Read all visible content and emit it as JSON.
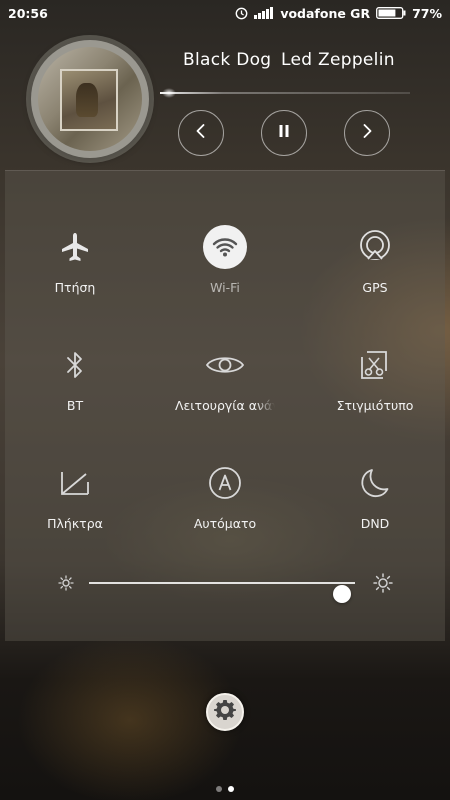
{
  "status_bar": {
    "time": "20:56",
    "carrier": "vodafone GR",
    "battery_percent": "77%",
    "battery_level": 0.77,
    "icons": [
      "alarm-icon",
      "signal-icon",
      "battery-icon"
    ]
  },
  "player": {
    "title": "Black Dog",
    "artist": "Led Zeppelin",
    "controls": [
      "previous-icon",
      "pause-icon",
      "next-icon"
    ]
  },
  "quick_settings": {
    "tiles": [
      {
        "label": "Πτήση",
        "icon": "airplane-icon",
        "active": false
      },
      {
        "label": "Wi-Fi",
        "icon": "wifi-icon",
        "active": true
      },
      {
        "label": "GPS",
        "icon": "gps-icon",
        "active": false
      },
      {
        "label": "BT",
        "icon": "bluetooth-icon",
        "active": false
      },
      {
        "label": "Λειτουργία ανάγνωσης",
        "icon": "eye-icon",
        "active": false
      },
      {
        "label": "Στιγμιότυπο",
        "icon": "screenshot-icon",
        "active": false
      },
      {
        "label": "Πλήκτρα",
        "icon": "keys-icon",
        "active": false
      },
      {
        "label": "Αυτόματο",
        "icon": "auto-brightness-icon",
        "active": false
      },
      {
        "label": "DND",
        "icon": "moon-icon",
        "active": false
      }
    ]
  },
  "brightness": {
    "level": 0.95,
    "icons": [
      "brightness-low-icon",
      "brightness-high-icon"
    ]
  },
  "pager": {
    "count": 2,
    "active_index": 1
  },
  "colors": {
    "accent": "#ffffff",
    "active_tile_bg": "#f1f1f1"
  }
}
